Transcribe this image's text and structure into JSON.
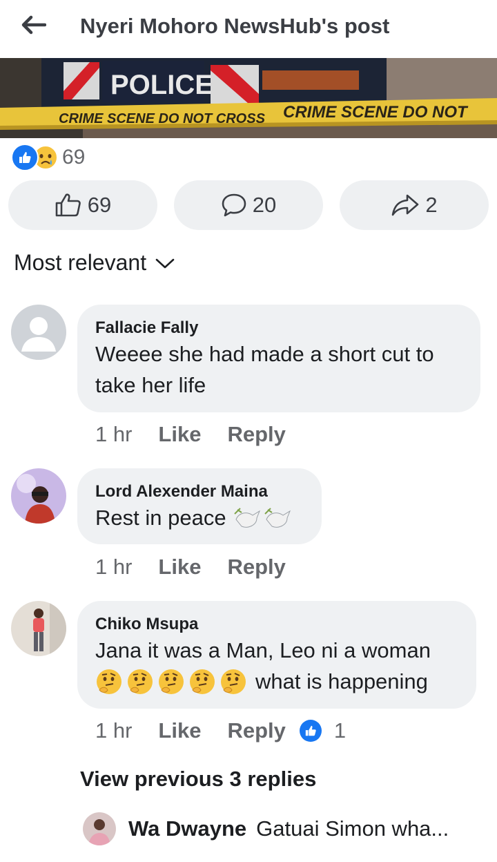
{
  "header": {
    "title": "Nyeri Mohoro NewsHub's post"
  },
  "post_image": {
    "police_sign": "POLICE",
    "tape_text_1": "CRIME SCENE DO NOT CROSS",
    "tape_text_2": "CRIME SCENE DO NOT"
  },
  "reactions": {
    "count": "69"
  },
  "actions": {
    "like_count": "69",
    "comment_count": "20",
    "share_count": "2"
  },
  "sort": {
    "label": "Most relevant"
  },
  "comments": [
    {
      "name": "Fallacie Fally",
      "text_line1": "Weeee she had made a short cut to",
      "text_line2": "take her life",
      "time": "1 hr",
      "like_label": "Like",
      "reply_label": "Reply"
    },
    {
      "name": "Lord Alexender Maina",
      "text": "Rest in peace",
      "time": "1 hr",
      "like_label": "Like",
      "reply_label": "Reply"
    },
    {
      "name": "Chiko Msupa",
      "text_line1": "Jana it was a Man, Leo ni a woman",
      "text_line2": "what is happening",
      "time": "1 hr",
      "like_label": "Like",
      "reply_label": "Reply",
      "like_count": "1"
    }
  ],
  "view_previous": "View previous 3 replies",
  "reply_preview": {
    "name": "Wa Dwayne",
    "text": "Gatuai Simon wha..."
  },
  "colors": {
    "accent": "#1877f2",
    "bubble": "#eff1f3",
    "muted": "#65676b",
    "tape": "#e8c43a"
  }
}
